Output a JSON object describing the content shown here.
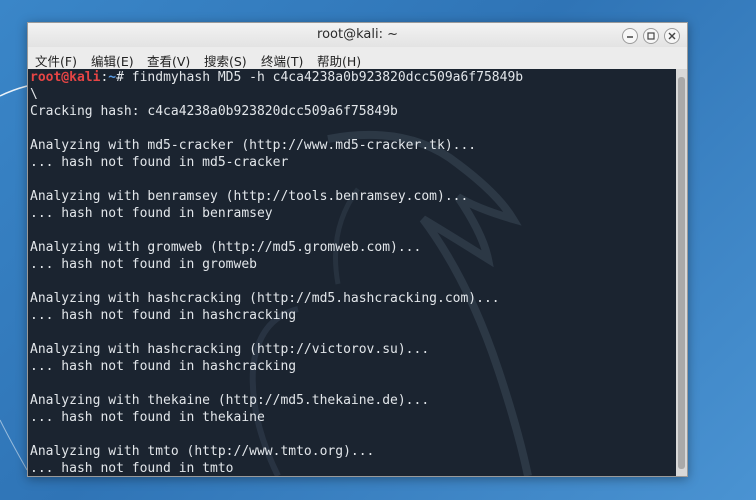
{
  "window": {
    "title": "root@kali: ~"
  },
  "menu": [
    "文件(F)",
    "编辑(E)",
    "查看(V)",
    "搜索(S)",
    "终端(T)",
    "帮助(H)"
  ],
  "prompt": {
    "user": "root@kali",
    "path": "~",
    "symbol": "#",
    "command": "findmyhash MD5 -h c4ca4238a0b923820dcc509a6f75849b"
  },
  "output": [
    "\\",
    "Cracking hash: c4ca4238a0b923820dcc509a6f75849b",
    "",
    "Analyzing with md5-cracker (http://www.md5-cracker.tk)...",
    "... hash not found in md5-cracker",
    "",
    "Analyzing with benramsey (http://tools.benramsey.com)...",
    "... hash not found in benramsey",
    "",
    "Analyzing with gromweb (http://md5.gromweb.com)...",
    "... hash not found in gromweb",
    "",
    "Analyzing with hashcracking (http://md5.hashcracking.com)...",
    "... hash not found in hashcracking",
    "",
    "Analyzing with hashcracking (http://victorov.su)...",
    "... hash not found in hashcracking",
    "",
    "Analyzing with thekaine (http://md5.thekaine.de)...",
    "... hash not found in thekaine",
    "",
    "Analyzing with tmto (http://www.tmto.org)...",
    "... hash not found in tmto"
  ],
  "colors": {
    "terminal_bg": "#1b2430",
    "prompt_user": "#e64545",
    "prompt_path": "#5a9ee8",
    "text": "#e2e6ea"
  },
  "icons": [
    "minimize-icon",
    "maximize-icon",
    "close-icon"
  ]
}
